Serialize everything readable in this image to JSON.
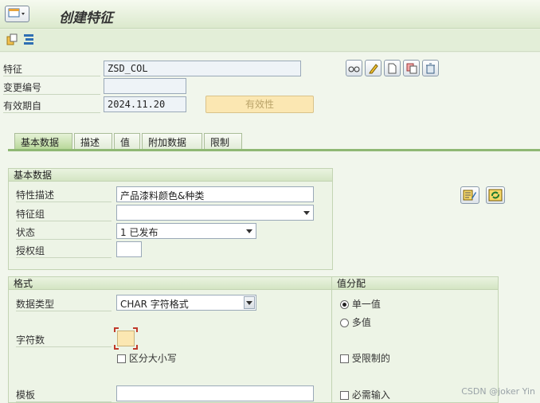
{
  "title": "创建特征",
  "header": {
    "feature_label": "特征",
    "feature_value": "ZSD_COL",
    "change_no_label": "变更编号",
    "change_no_value": "",
    "valid_from_label": "有效期自",
    "valid_from_value": "2024.11.20",
    "validity_button": "有效性"
  },
  "tabs": [
    {
      "label": "基本数据",
      "active": true
    },
    {
      "label": "描述"
    },
    {
      "label": "值"
    },
    {
      "label": "附加数据"
    },
    {
      "label": "限制"
    }
  ],
  "basic_group": {
    "title": "基本数据",
    "desc_label": "特性描述",
    "desc_value": "产品漆料颜色&种类",
    "group_label": "特征组",
    "group_value": "",
    "status_label": "状态",
    "status_value": "1 已发布",
    "auth_label": "授权组",
    "auth_value": ""
  },
  "format_group": {
    "title": "格式",
    "datatype_label": "数据类型",
    "datatype_value": "CHAR 字符格式",
    "chars_label": "字符数",
    "chars_value": "",
    "case_label": "区分大小写",
    "template_label": "模板",
    "template_value": ""
  },
  "value_assign": {
    "title": "值分配",
    "single_label": "单一值",
    "multi_label": "多值",
    "restricted_label": "受限制的",
    "required_label": "必需输入"
  },
  "watermark": "CSDN @joker Yin",
  "colors": {
    "accent_green": "#8fb874",
    "validity_bg": "#fbe7b2"
  }
}
